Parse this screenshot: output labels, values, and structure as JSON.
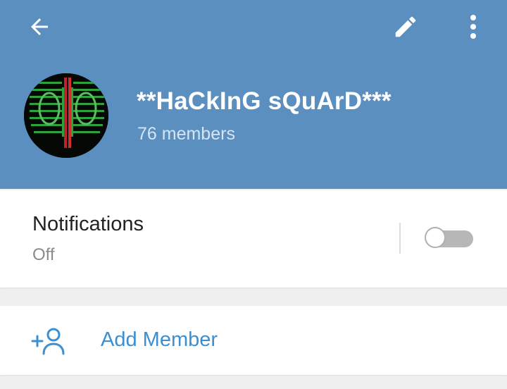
{
  "header": {
    "group_name": "**HaCkInG sQuArD***",
    "member_count": "76 members",
    "icons": {
      "back": "arrow-left-icon",
      "edit": "pencil-icon",
      "more": "more-vert-icon"
    }
  },
  "notifications": {
    "label": "Notifications",
    "value": "Off",
    "toggle_on": false
  },
  "add_member": {
    "label": "Add Member",
    "icon": "add-person-icon"
  },
  "colors": {
    "header_bg": "#5a8fc0",
    "accent": "#3c8fd0"
  }
}
